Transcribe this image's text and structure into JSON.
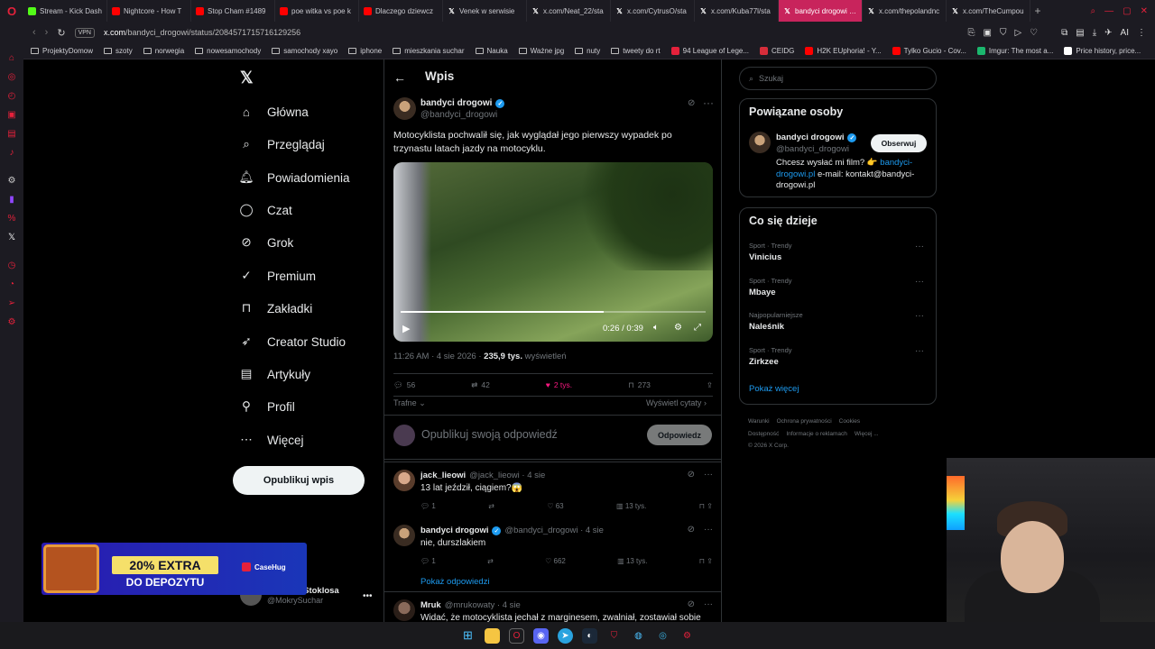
{
  "browser": {
    "tabs": [
      {
        "label": "Stream - Kick Dash",
        "color": "#53fc18"
      },
      {
        "label": "Nightcore - How T",
        "color": "#ff0000"
      },
      {
        "label": "Stop Cham #1489",
        "color": "#ff0000"
      },
      {
        "label": "poe witka vs poe k",
        "color": "#ff0000"
      },
      {
        "label": "Dlaczego dziewcz",
        "color": "#ff0000"
      },
      {
        "label": "Venek w serwisie",
        "color": "#ffffff"
      },
      {
        "label": "x.com/Neat_22/sta",
        "color": "#ffffff"
      },
      {
        "label": "x.com/CytrusO/sta",
        "color": "#ffffff"
      },
      {
        "label": "x.com/Kuba77l/sta",
        "color": "#ffffff"
      },
      {
        "label": "bandyci drogowi w serwisie",
        "color": "#ffffff",
        "active": true
      },
      {
        "label": "x.com/thepolandnc",
        "color": "#ffffff"
      },
      {
        "label": "x.com/TheCumpou",
        "color": "#ffffff"
      }
    ],
    "vpn": "VPN",
    "url_host": "x.com",
    "url_path": "/bandyci_drogowi/status/2084571715716129256",
    "bookmarks": [
      {
        "label": "ProjektyDomow",
        "type": "folder"
      },
      {
        "label": "szoty",
        "type": "folder"
      },
      {
        "label": "norwegia",
        "type": "folder"
      },
      {
        "label": "nowesamochody",
        "type": "folder"
      },
      {
        "label": "samochody xayo",
        "type": "folder"
      },
      {
        "label": "iphone",
        "type": "folder"
      },
      {
        "label": "mieszkania suchar",
        "type": "folder"
      },
      {
        "label": "Nauka",
        "type": "folder"
      },
      {
        "label": "Ważne jpg",
        "type": "folder"
      },
      {
        "label": "nuty",
        "type": "folder"
      },
      {
        "label": "tweety do rt",
        "type": "folder"
      },
      {
        "label": "94 League of Lege...",
        "type": "site",
        "color": "#e5213b"
      },
      {
        "label": "CEIDG",
        "type": "site",
        "color": "#d62d3a"
      },
      {
        "label": "H2K EUphoria! - Y...",
        "type": "site",
        "color": "#ff0000"
      },
      {
        "label": "Tylko Gucio - Cov...",
        "type": "site",
        "color": "#ff0000"
      },
      {
        "label": "Imgur: The most a...",
        "type": "site",
        "color": "#1bb76e"
      },
      {
        "label": "Price history, price...",
        "type": "site",
        "color": "#ffffff"
      }
    ],
    "ai_label": "AI"
  },
  "nav": {
    "items": [
      {
        "label": "Główna",
        "icon": "home-icon"
      },
      {
        "label": "Przeglądaj",
        "icon": "search-icon"
      },
      {
        "label": "Powiadomienia",
        "icon": "bell-icon"
      },
      {
        "label": "Czat",
        "icon": "chat-icon"
      },
      {
        "label": "Grok",
        "icon": "grok-icon"
      },
      {
        "label": "Premium",
        "icon": "premium-icon"
      },
      {
        "label": "Zakładki",
        "icon": "bookmark-icon"
      },
      {
        "label": "Creator Studio",
        "icon": "rocket-icon"
      },
      {
        "label": "Artykuły",
        "icon": "article-icon"
      },
      {
        "label": "Profil",
        "icon": "user-icon"
      },
      {
        "label": "Więcej",
        "icon": "more-icon"
      }
    ],
    "post_button": "Opublikuj wpis",
    "profile_name": "Dominik Stoklosa",
    "profile_handle": "@MokrySuchar"
  },
  "promo": {
    "line1": "20% EXTRA",
    "line2": "DO DEPOZYTU",
    "brand": "CaseHug"
  },
  "post": {
    "header_title": "Wpis",
    "author_name": "bandyci drogowi",
    "author_handle": "@bandyci_drogowi",
    "text": "Motocyklista pochwalił się, jak wyglądał jego pierwszy wypadek po trzynastu latach jazdy na motocyklu.",
    "video_time": "0:26 / 0:39",
    "video_progress": 0.667,
    "time": "11:26 AM · 4 sie 2026 · ",
    "views": "235,9 tys.",
    "views_label": " wyświetleń",
    "replies": "56",
    "reposts": "42",
    "likes": "2 tys.",
    "bookmarks": "273",
    "sort_label": "Trafne",
    "quotes_label": "Wyświetl cytaty",
    "reply_placeholder": "Opublikuj swoją odpowiedź",
    "reply_button": "Odpowiedz"
  },
  "replies": [
    {
      "name": "jack_lieowi",
      "handle": "@jack_lieowi · 4 sie",
      "text": "13 lat jeździł, ciągiem?😱",
      "replies": "1",
      "reposts": "",
      "likes": "63",
      "views": "13 tys.",
      "verified": false
    },
    {
      "name": "bandyci drogowi",
      "handle": "@bandyci_drogowi · 4 sie",
      "text": "nie, durszlakiem",
      "replies": "1",
      "reposts": "",
      "likes": "662",
      "views": "13 tys.",
      "verified": true
    },
    {
      "name": "Mruk",
      "handle": "@mrukowaty · 4 sie",
      "text": "Widać, że motocyklista jechał z marginesem, zwalniał, zostawiał sobie",
      "verified": false
    }
  ],
  "show_replies": "Pokaż odpowiedzi",
  "sidebar": {
    "search_placeholder": "Szukaj",
    "related_title": "Powiązane osoby",
    "related_name": "bandyci drogowi",
    "related_handle": "@bandyci_drogowi",
    "follow_button": "Obserwuj",
    "bio_pre": "Chcesz wysłać mi film? 👉 ",
    "bio_link": "bandyci-drogowi.pl",
    "bio_post": " e-mail: kontakt@bandyci-drogowi.pl",
    "trends_title": "Co się dzieje",
    "trends": [
      {
        "category": "Sport · Trendy",
        "name": "Vinicius"
      },
      {
        "category": "Sport · Trendy",
        "name": "Mbaye"
      },
      {
        "category": "Najpopularniejsze",
        "name": "Naleśnik"
      },
      {
        "category": "Sport · Trendy",
        "name": "Zirkzee"
      }
    ],
    "show_more": "Pokaż więcej",
    "footer": [
      "Warunki",
      "Ochrona prywatności",
      "Cookies",
      "Dostępność",
      "Informacje o reklamach",
      "Więcej ...",
      "© 2026 X Corp."
    ]
  },
  "colors": {
    "accent": "#1d9bf0",
    "like": "#f91880",
    "opera": "#e5213b"
  }
}
